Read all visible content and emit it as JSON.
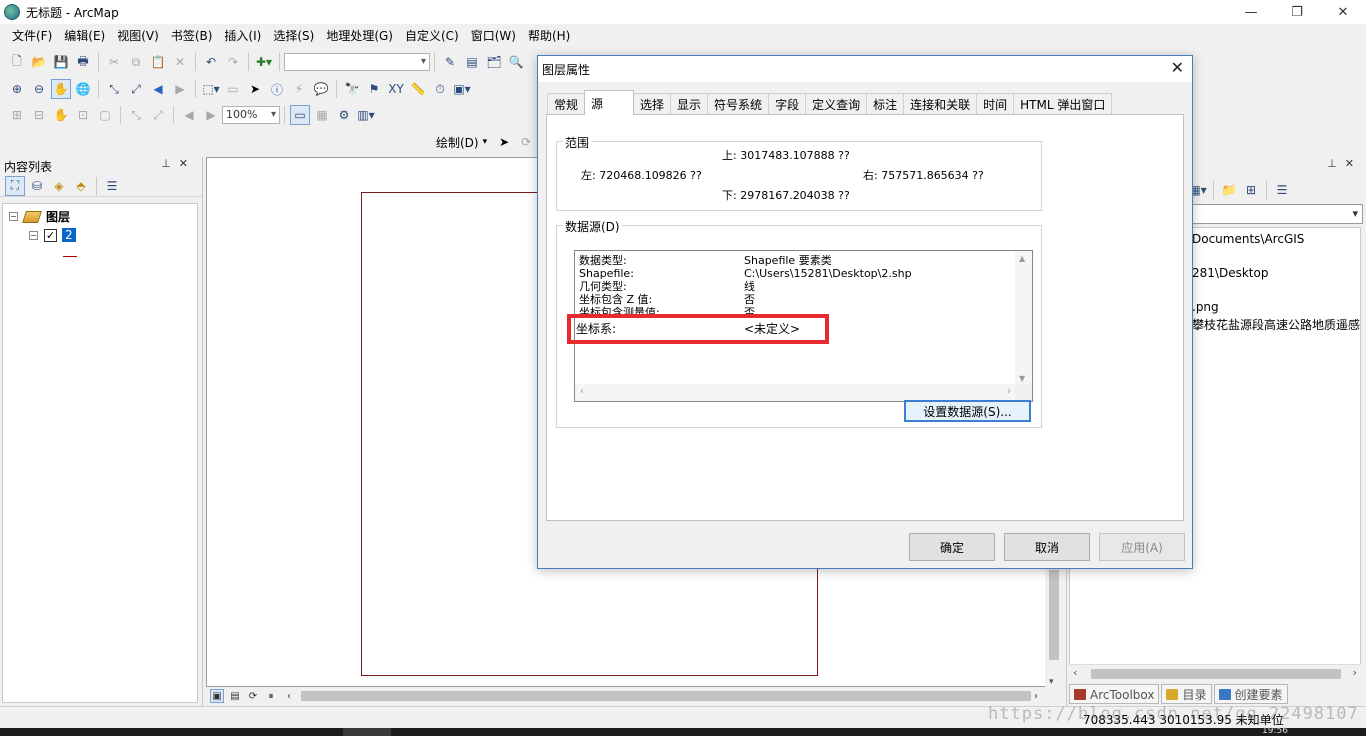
{
  "window": {
    "title": "无标题 - ArcMap",
    "controls": [
      "—",
      "❐",
      "✕"
    ]
  },
  "menu": [
    "文件(F)",
    "编辑(E)",
    "视图(V)",
    "书签(B)",
    "插入(I)",
    "选择(S)",
    "地理处理(G)",
    "自定义(C)",
    "窗口(W)",
    "帮助(H)"
  ],
  "toolbar": {
    "zoom": "100%",
    "draw_label": "绘制(D)"
  },
  "toc": {
    "title": "内容列表",
    "root_label": "图层",
    "layer_label": "2"
  },
  "catalog": {
    "lines": [
      "Documents\\ArcGIS",
      "281\\Desktop",
      ".png",
      "攀枝花盐源段高速公路地质遥感"
    ],
    "tabs": [
      "ArcToolbox",
      "目录",
      "创建要素"
    ]
  },
  "status": {
    "coords": "708335.443  3010153.95 未知单位",
    "watermark": "https://blog.csdn.net/qq_22498107",
    "clock": "19:56"
  },
  "dialog": {
    "title": "图层属性",
    "tabs": [
      "常规",
      "源",
      "选择",
      "显示",
      "符号系统",
      "字段",
      "定义查询",
      "标注",
      "连接和关联",
      "时间",
      "HTML 弹出窗口"
    ],
    "active_tab": "源",
    "extent": {
      "label": "范围",
      "top": "上:  3017483.107888 ??",
      "left": "左:  720468.109826 ??",
      "right": "右:  757571.865634 ??",
      "bottom": "下:  2978167.204038 ??"
    },
    "datasource": {
      "label": "数据源(D)",
      "rows": [
        {
          "key": "数据类型:",
          "value": "Shapefile 要素类"
        },
        {
          "key": "Shapefile:",
          "value": "C:\\Users\\15281\\Desktop\\2.shp"
        },
        {
          "key": "几何类型:",
          "value": "线"
        },
        {
          "key": "坐标包含 Z 值:",
          "value": "否"
        },
        {
          "key": "坐标包含测量值:",
          "value": "否"
        }
      ],
      "coord_sys_key": "坐标系:",
      "coord_sys_value": "<未定义>",
      "set_button": "设置数据源(S)..."
    },
    "buttons": {
      "ok": "确定",
      "cancel": "取消",
      "apply": "应用(A)"
    }
  }
}
